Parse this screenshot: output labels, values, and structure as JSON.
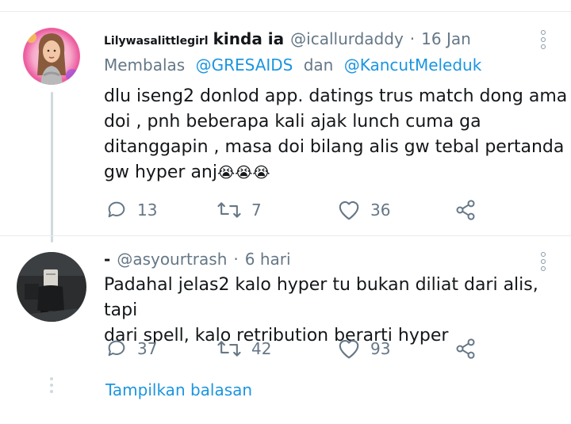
{
  "tweet1": {
    "display_name": "Lilywasalittlegirl",
    "display_name_suffix": "kinda ia",
    "handle": "@icallurdaddy",
    "separator": "·",
    "time": "16 Jan",
    "reply_prefix": "Membalas",
    "reply_to_1": "@GRESAIDS",
    "reply_joiner": "dan",
    "reply_to_2": "@KancutMeleduk",
    "text_line1": "dlu iseng2 donlod app. datings trus match dong ama",
    "text_line2": "doi , pnh beberapa kali ajak lunch cuma ga",
    "text_line3": "ditanggapin , masa doi bilang alis gw tebal pertanda",
    "text_line4": "gw hyper anj",
    "emoji": "😭😭😭",
    "replies": "13",
    "retweets": "7",
    "likes": "36"
  },
  "tweet2": {
    "display_name": "-",
    "handle": "@asyourtrash",
    "separator": "·",
    "time": "6 hari",
    "text_line1": "Padahal jelas2 kalo hyper tu bukan diliat dari alis, tapi",
    "text_line2": "dari spell, kalo retribution berarti hyper",
    "replies": "37",
    "retweets": "42",
    "likes": "93"
  },
  "show_replies_label": "Tampilkan balasan",
  "colors": {
    "link": "#1b95e0",
    "muted": "#657786",
    "text": "#14171a",
    "divider": "#e6ecf0"
  }
}
